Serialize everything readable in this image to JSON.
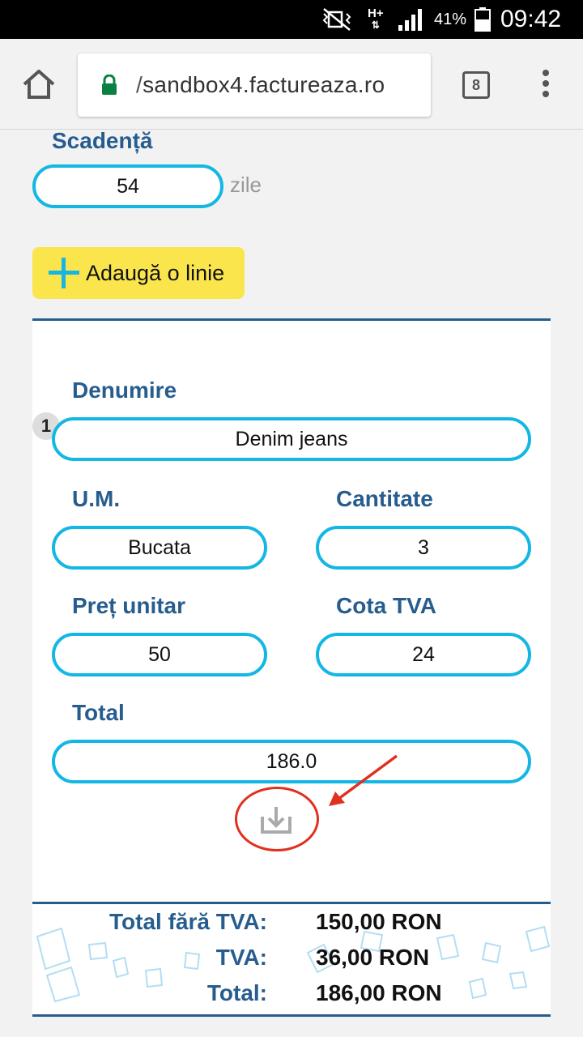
{
  "status_bar": {
    "network": "H+",
    "battery_percent": "41%",
    "time": "09:42",
    "icons": [
      "mute-vibrate-icon",
      "hplus-icon",
      "signal-icon",
      "battery-icon"
    ]
  },
  "browser": {
    "url_prefix": "/",
    "url_host": "sandbox4.factureaza.ro",
    "tab_count": "8",
    "icons": [
      "home-icon",
      "lock-icon",
      "tabs-icon",
      "overflow-menu-icon"
    ]
  },
  "form": {
    "scadenta_label": "Scadență",
    "scadenta_value": "54",
    "scadenta_unit": "zile",
    "add_line_label": "Adaugă o linie",
    "line": {
      "number": "1",
      "denumire_label": "Denumire",
      "denumire_value": "Denim jeans",
      "um_label": "U.M.",
      "um_value": "Bucata",
      "cantitate_label": "Cantitate",
      "cantitate_value": "3",
      "pret_label": "Preț unitar",
      "pret_value": "50",
      "tva_label": "Cota TVA",
      "tva_value": "24",
      "total_label": "Total",
      "total_value": "186.0"
    }
  },
  "totals": {
    "fara_tva_label": "Total fără TVA:",
    "fara_tva_value": "150,00 RON",
    "tva_label": "TVA:",
    "tva_value": "36,00 RON",
    "total_label": "Total:",
    "total_value": "186,00 RON"
  },
  "colors": {
    "accent": "#14b7e4",
    "label": "#275d8e",
    "add_button": "#fbe54d",
    "annotation": "#e0301e"
  }
}
